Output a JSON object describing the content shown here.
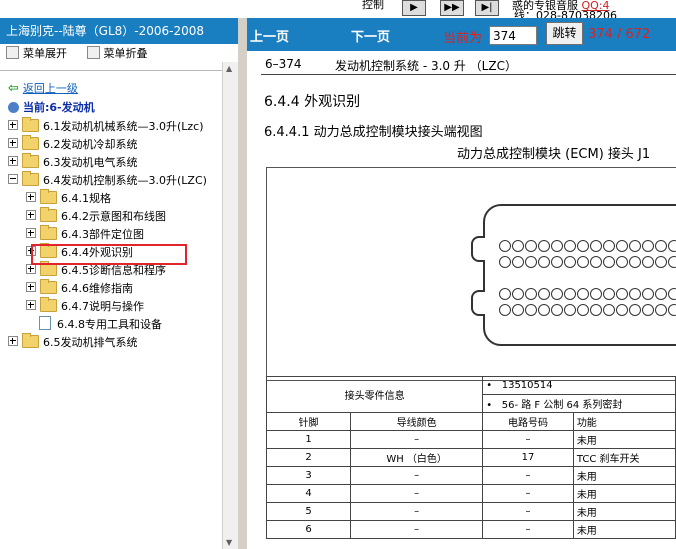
{
  "top": {
    "control_label": "控制",
    "service_text": "惑的专银音服",
    "service_link": "QQ:4",
    "phone_text": "线：028-87038206"
  },
  "left": {
    "title": "上海别克--陆尊（GL8）-2006-2008",
    "expand_label": "菜单展开",
    "collapse_label": "菜单折叠",
    "back_label": "返回上一级",
    "current_label": "当前:6-发动机",
    "tree": [
      {
        "label": "6.1发动机机械系统—3.0升(Lzc)"
      },
      {
        "label": "6.2发动机冷却系统"
      },
      {
        "label": "6.3发动机电气系统"
      },
      {
        "label": "6.4发动机控制系统—3.0升(LZC)"
      },
      {
        "label": "6.4.1规格"
      },
      {
        "label": "6.4.2示意图和布线图"
      },
      {
        "label": "6.4.3部件定位图"
      },
      {
        "label": "6.4.4外观识别"
      },
      {
        "label": "6.4.5诊断信息和程序"
      },
      {
        "label": "6.4.6维修指南"
      },
      {
        "label": "6.4.7说明与操作"
      },
      {
        "label": "6.4.8专用工具和设备"
      },
      {
        "label": "6.5发动机排气系统"
      }
    ]
  },
  "nav": {
    "prev_label": "上一页",
    "next_label": "下一页",
    "current_prefix": "当前为",
    "page_value": "374",
    "go_label": "跳转",
    "page_count": "374 / 672"
  },
  "doc": {
    "page_ref": "6–374",
    "running_title": "发动机控制系统 - 3.0 升 （LZC）",
    "section": "6.4.4 外观识别",
    "subsection": "6.4.4.1 动力总成控制模块接头端视图",
    "figure_title": "动力总成控制模块 (ECM) 接头 J1",
    "info_header": "接头零件信息",
    "info_bullets": [
      "13510514",
      "56- 路 F 公制 64 系列密封"
    ],
    "table_headers": [
      "针脚",
      "导线颜色",
      "电路号码",
      "功能"
    ],
    "table_rows": [
      [
        "1",
        "–",
        "–",
        "未用"
      ],
      [
        "2",
        "WH （白色）",
        "17",
        "TCC 刹车开关"
      ],
      [
        "3",
        "–",
        "–",
        "未用"
      ],
      [
        "4",
        "–",
        "–",
        "未用"
      ],
      [
        "5",
        "–",
        "–",
        "未用"
      ],
      [
        "6",
        "–",
        "–",
        "未用"
      ]
    ]
  },
  "colors": {
    "accent": "#1a7fc0",
    "highlight_border": "#e0252d",
    "page_count": "#e01f1f"
  }
}
